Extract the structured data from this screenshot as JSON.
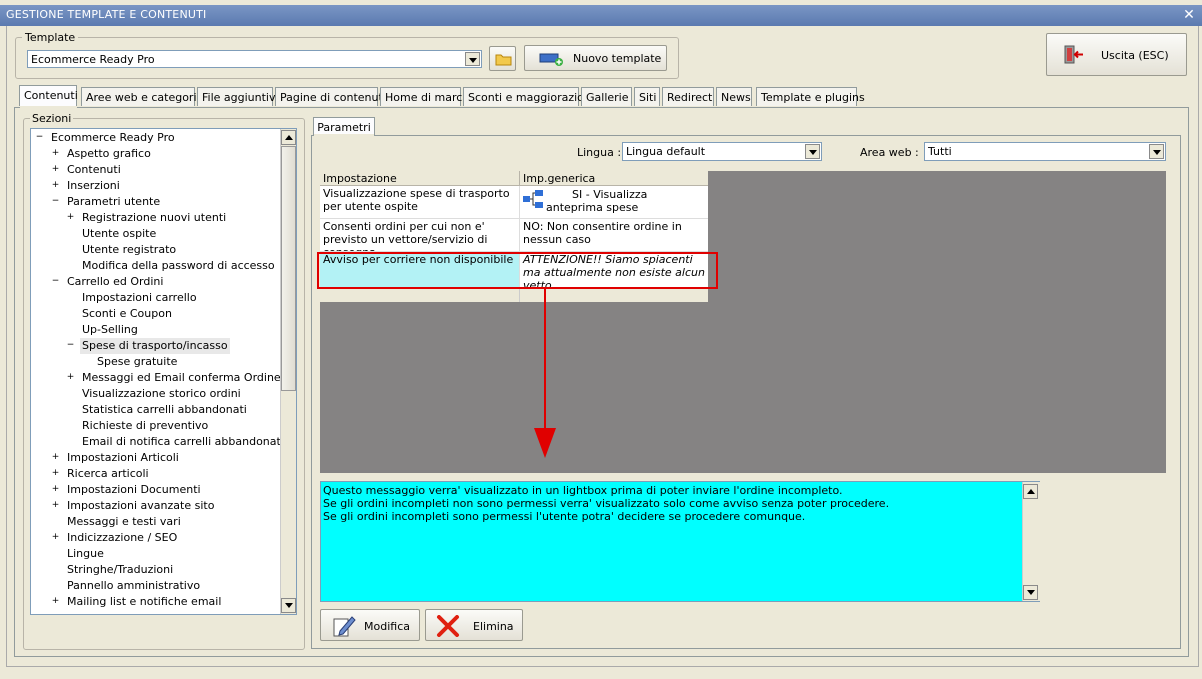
{
  "window": {
    "title": "GESTIONE TEMPLATE E CONTENUTI",
    "close_glyph": "✕"
  },
  "template_group": {
    "label": "Template",
    "selected": "Ecommerce Ready Pro",
    "new_button": "Nuovo template"
  },
  "exit_button": "Uscita (ESC)",
  "tabs": [
    {
      "label": "Contenuti",
      "active": true
    },
    {
      "label": "Aree web e categorie"
    },
    {
      "label": "File aggiuntivi"
    },
    {
      "label": "Pagine di contenuti"
    },
    {
      "label": "Home di marca"
    },
    {
      "label": "Sconti e maggiorazioni"
    },
    {
      "label": "Gallerie"
    },
    {
      "label": "Siti"
    },
    {
      "label": "Redirect"
    },
    {
      "label": "News"
    },
    {
      "label": "Template e plugins"
    }
  ],
  "sections": {
    "label": "Sezioni",
    "tree": [
      {
        "label": "Ecommerce Ready Pro",
        "level": 0,
        "exp": "−"
      },
      {
        "label": "Aspetto grafico",
        "level": 1,
        "exp": "+"
      },
      {
        "label": "Contenuti",
        "level": 1,
        "exp": "+"
      },
      {
        "label": "Inserzioni",
        "level": 1,
        "exp": "+"
      },
      {
        "label": "Parametri utente",
        "level": 1,
        "exp": "−"
      },
      {
        "label": "Registrazione nuovi utenti",
        "level": 2,
        "exp": "+"
      },
      {
        "label": "Utente ospite",
        "level": 2,
        "exp": ""
      },
      {
        "label": "Utente registrato",
        "level": 2,
        "exp": ""
      },
      {
        "label": "Modifica della password di accesso",
        "level": 2,
        "exp": ""
      },
      {
        "label": "Carrello ed Ordini",
        "level": 1,
        "exp": "−"
      },
      {
        "label": "Impostazioni carrello",
        "level": 2,
        "exp": ""
      },
      {
        "label": "Sconti e Coupon",
        "level": 2,
        "exp": ""
      },
      {
        "label": "Up-Selling",
        "level": 2,
        "exp": ""
      },
      {
        "label": "Spese di trasporto/incasso",
        "level": 2,
        "exp": "−",
        "selected": true
      },
      {
        "label": "Spese gratuite",
        "level": 3,
        "exp": ""
      },
      {
        "label": "Messaggi ed Email conferma Ordine",
        "level": 2,
        "exp": "+"
      },
      {
        "label": "Visualizzazione storico ordini",
        "level": 2,
        "exp": ""
      },
      {
        "label": "Statistica carrelli abbandonati",
        "level": 2,
        "exp": ""
      },
      {
        "label": "Richieste di preventivo",
        "level": 2,
        "exp": ""
      },
      {
        "label": "Email di notifica carrelli abbandonati",
        "level": 2,
        "exp": ""
      },
      {
        "label": "Impostazioni Articoli",
        "level": 1,
        "exp": "+"
      },
      {
        "label": "Ricerca articoli",
        "level": 1,
        "exp": "+"
      },
      {
        "label": "Impostazioni Documenti",
        "level": 1,
        "exp": "+"
      },
      {
        "label": "Impostazioni avanzate sito",
        "level": 1,
        "exp": "+"
      },
      {
        "label": "Messaggi e testi vari",
        "level": 1,
        "exp": ""
      },
      {
        "label": "Indicizzazione / SEO",
        "level": 1,
        "exp": "+"
      },
      {
        "label": "Lingue",
        "level": 1,
        "exp": ""
      },
      {
        "label": "Stringhe/Traduzioni",
        "level": 1,
        "exp": ""
      },
      {
        "label": "Pannello amministrativo",
        "level": 1,
        "exp": ""
      },
      {
        "label": "Mailing list e notifiche email",
        "level": 1,
        "exp": "+"
      }
    ]
  },
  "params": {
    "tab_label": "Parametri",
    "lingua_label": "Lingua :",
    "lingua_value": "Lingua default",
    "area_label": "Area web :",
    "area_value": "Tutti",
    "grid_headers": [
      "Impostazione",
      "Imp.generica"
    ],
    "grid_rows": [
      {
        "setting": "Visualizzazione spese di trasporto per utente ospite",
        "value": "SI - Visualizza anteprima spese"
      },
      {
        "setting": "Consenti ordini per cui non e' previsto un vettore/servizio di consegna",
        "value": "NO: Non consentire ordine in nessun caso"
      },
      {
        "setting": "Avviso per corriere non disponibile",
        "value": "ATTENZIONE!! Siamo spiacenti ma attualmente non esiste alcun vetto..."
      }
    ],
    "description_lines": [
      "Questo messaggio verra' visualizzato in un lightbox prima di poter inviare l'ordine incompleto.",
      "Se gli ordini incompleti non sono permessi verra' visualizzato solo come avviso senza poter procedere.",
      "Se gli ordini incompleti sono permessi l'utente potra' decidere se procedere comunque."
    ],
    "modify_button": "Modifica",
    "delete_button": "Elimina"
  },
  "colors": {
    "highlight_row": "#b3f2f5",
    "description_bg": "#00ffff",
    "grid_empty": "#858383",
    "annotation_red": "#e00000"
  }
}
